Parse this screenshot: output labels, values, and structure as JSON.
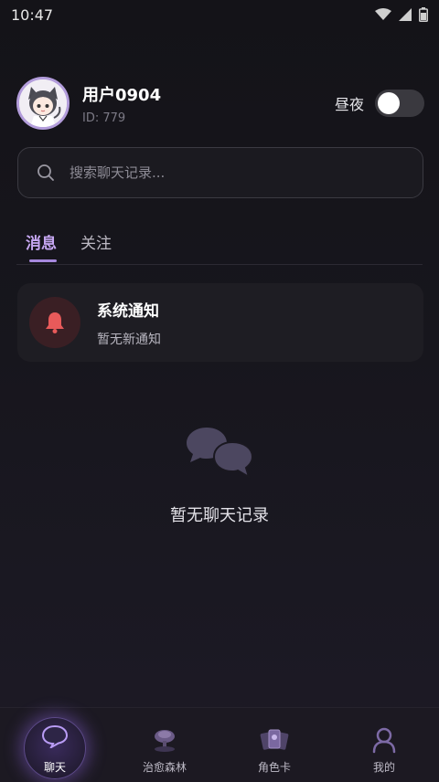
{
  "status_bar": {
    "time": "10:47"
  },
  "profile": {
    "name": "用户0904",
    "id_text": "ID: 779",
    "theme_label": "昼夜",
    "theme_toggle_on": false
  },
  "search": {
    "placeholder": "搜索聊天记录..."
  },
  "tabs": [
    {
      "label": "消息",
      "active": true
    },
    {
      "label": "关注",
      "active": false
    }
  ],
  "notification": {
    "title": "系统通知",
    "subtitle": "暂无新通知",
    "icon": "bell-icon",
    "icon_color": "#e85a5a"
  },
  "empty_state": {
    "icon": "chat-bubbles-icon",
    "text": "暂无聊天记录"
  },
  "bottom_nav": [
    {
      "label": "聊天",
      "icon": "chat-icon",
      "active": true
    },
    {
      "label": "治愈森林",
      "icon": "tree-icon",
      "active": false
    },
    {
      "label": "角色卡",
      "icon": "cards-icon",
      "active": false
    },
    {
      "label": "我的",
      "icon": "profile-icon",
      "active": false
    }
  ],
  "colors": {
    "accent": "#c6a7f2",
    "background": "#141318",
    "card": "#1e1d23"
  }
}
